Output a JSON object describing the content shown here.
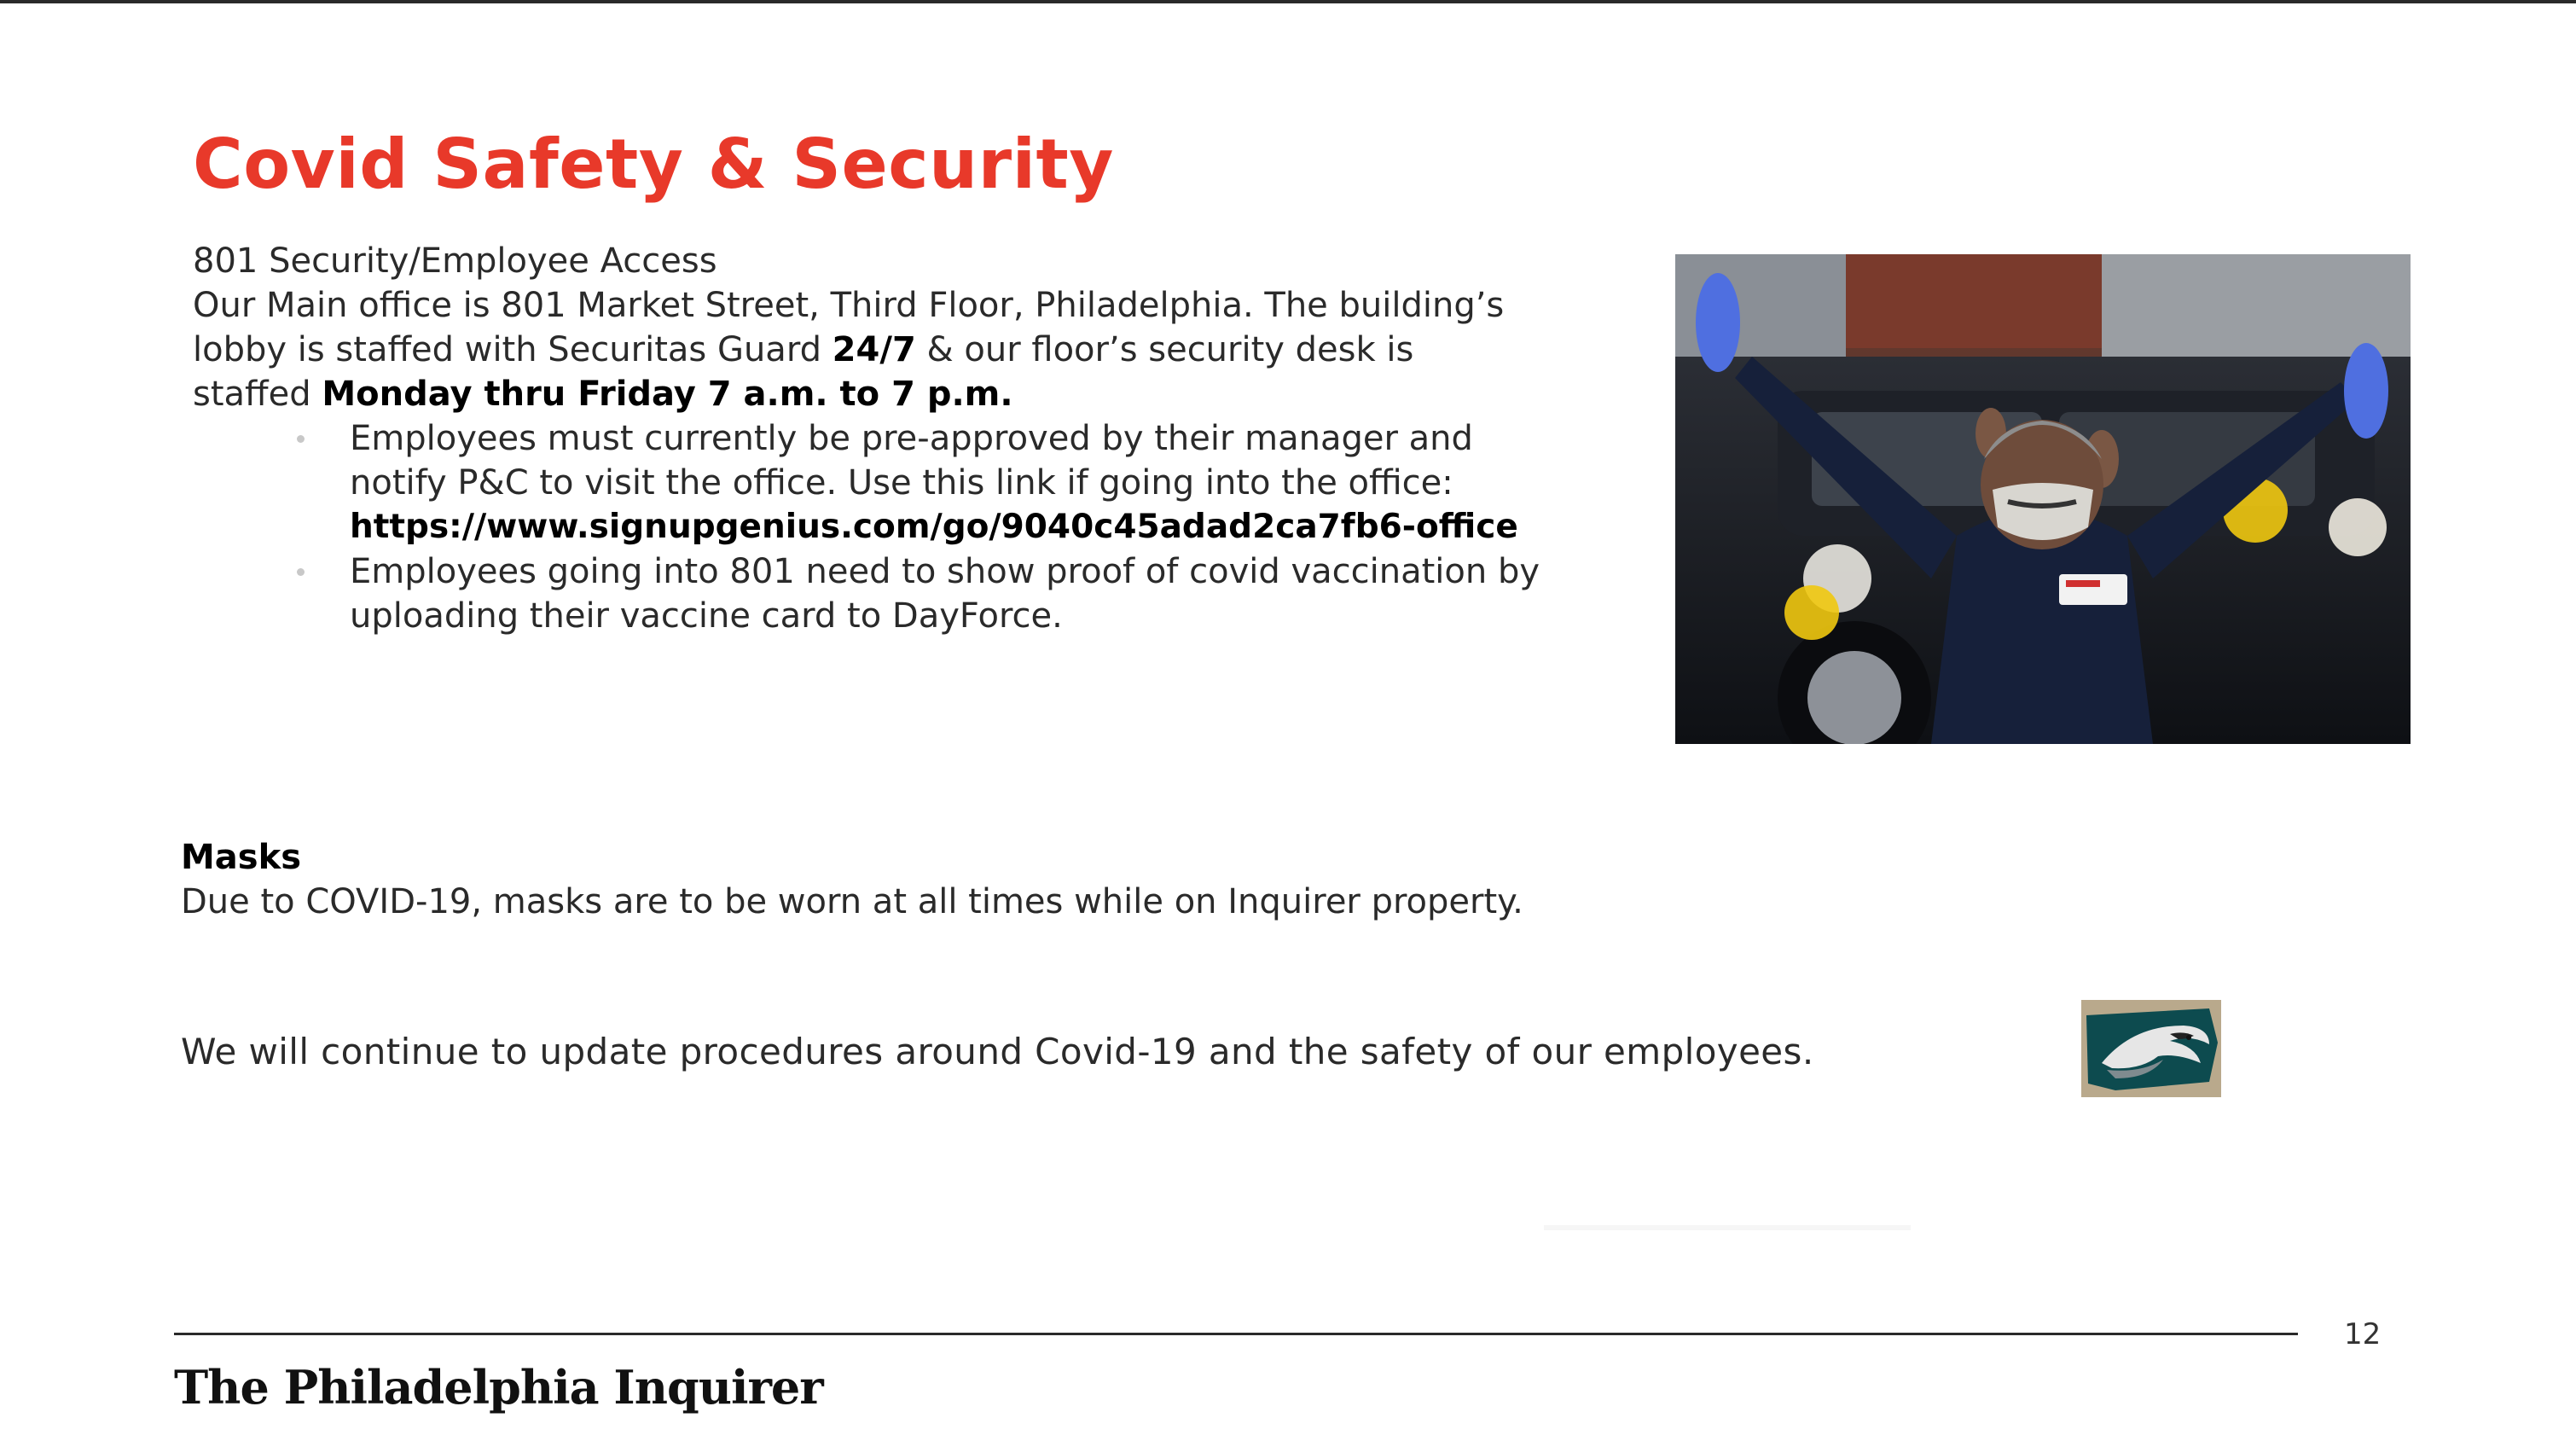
{
  "slide": {
    "title": "Covid Safety & Security",
    "intro": {
      "heading": "801 Security/Employee Access",
      "line1": "Our Main office is 801 Market Street, Third Floor, Philadelphia. The building’s",
      "line2_a": "lobby is staffed with Securitas Guard ",
      "line2_b": "24/7",
      "line2_c": " & our floor’s security desk is",
      "line3_a": "staffed ",
      "line3_b": "Monday thru Friday 7 a.m. to 7 p.m."
    },
    "bullets": [
      {
        "line1": "Employees must currently be pre-approved by their manager and",
        "line2": "notify P&C to visit the office. Use this link if going into the office:",
        "link": "https://www.signupgenius.com/go/9040c45adad2ca7fb6-office"
      },
      {
        "line1": "Employees going into 801 need to show proof of covid vaccination by",
        "line2": "uploading their vaccine card to DayForce."
      }
    ],
    "masks": {
      "heading": "Masks",
      "text": "Due to COVID-19, masks are to be worn at all times while on Inquirer property."
    },
    "update_text": "We will continue to update procedures around Covid-19 and the safety of our employees.",
    "page_number": "12",
    "footer_logo": "The Philadelphia Inquirer"
  },
  "colors": {
    "title": "#e8392a",
    "text": "#2a2a2a",
    "rule": "#2a2a2a"
  },
  "icons": {
    "photo": "security-guard-photo",
    "eagles": "eagles-logo-icon"
  }
}
